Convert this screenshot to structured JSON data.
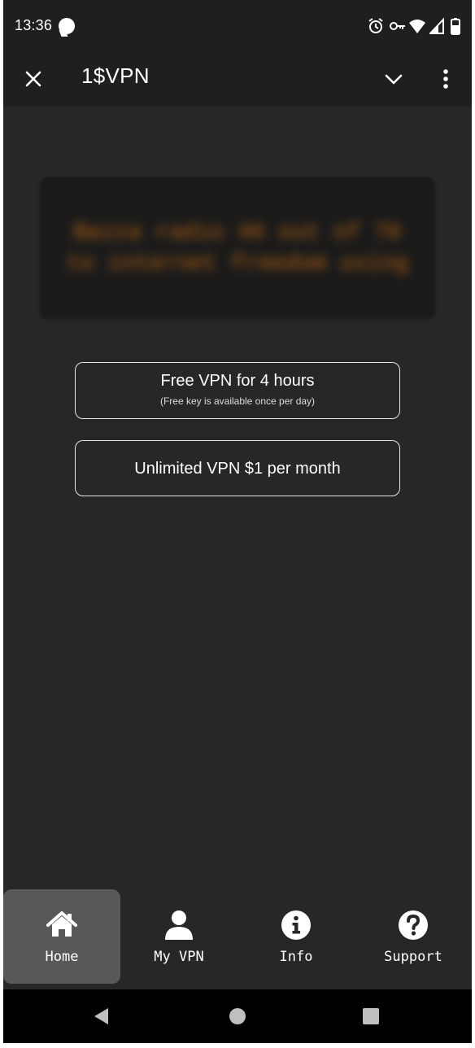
{
  "status_bar": {
    "time": "13:36",
    "icons": [
      "chat-bubble-icon",
      "alarm-icon",
      "vpn-key-icon",
      "wifi-icon",
      "signal-icon",
      "battery-icon"
    ]
  },
  "app_bar": {
    "title": "1$VPN",
    "icons": [
      "close-icon",
      "chevron-down-icon",
      "more-vert-icon"
    ]
  },
  "main": {
    "banner_text": "Bazza radio 46 out of 76 to internet freedom using",
    "free_button": {
      "label": "Free VPN for 4 hours",
      "sublabel": "(Free key is available once per day)"
    },
    "paid_button": {
      "label": "Unlimited VPN $1 per month"
    }
  },
  "bottom_nav": {
    "items": [
      {
        "label": "Home",
        "icon": "home-icon",
        "active": true
      },
      {
        "label": "My VPN",
        "icon": "person-icon",
        "active": false
      },
      {
        "label": "Info",
        "icon": "info-icon",
        "active": false
      },
      {
        "label": "Support",
        "icon": "help-icon",
        "active": false
      }
    ]
  },
  "system_nav": {
    "icons": [
      "back-icon",
      "home-circle-icon",
      "recents-icon"
    ]
  },
  "colors": {
    "background": "#272727",
    "bar": "#1f1f1f",
    "active_nav": "#585858",
    "banner_text": "#b8620f"
  }
}
